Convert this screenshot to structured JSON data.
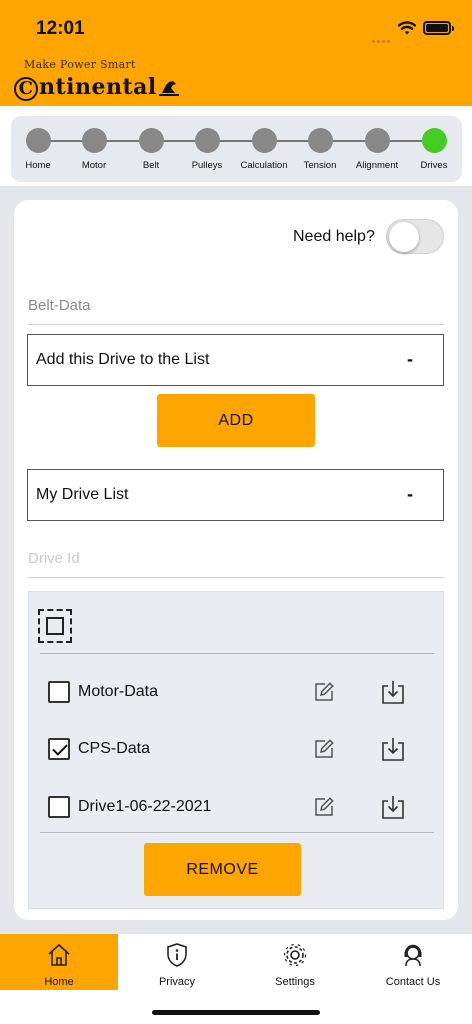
{
  "status_bar": {
    "time": "12:01"
  },
  "header": {
    "tagline": "Make Power Smart",
    "logo_text": "ntinental",
    "logo_initial": "C"
  },
  "stepper": {
    "steps": [
      {
        "label": "Home"
      },
      {
        "label": "Motor"
      },
      {
        "label": "Belt"
      },
      {
        "label": "Pulleys"
      },
      {
        "label": "Calculation"
      },
      {
        "label": "Tension"
      },
      {
        "label": "Alignment"
      },
      {
        "label": "Drives"
      }
    ],
    "active_step": "Drives"
  },
  "help": {
    "label": "Need help?",
    "enabled": false
  },
  "belt_data": {
    "label": "Belt-Data"
  },
  "add_drive": {
    "title": "Add this Drive to the List",
    "sign": "-",
    "button": "ADD"
  },
  "drive_list": {
    "title": "My Drive List",
    "sign": "-"
  },
  "drive_id": {
    "placeholder": "Drive Id"
  },
  "drives": {
    "items": [
      {
        "name": "Motor-Data",
        "checked": false
      },
      {
        "name": "CPS-Data",
        "checked": true
      },
      {
        "name": "Drive1-06-22-2021",
        "checked": false
      }
    ],
    "remove_button": "REMOVE"
  },
  "bottom_nav": {
    "items": [
      {
        "label": "Home",
        "icon": "home-icon",
        "active": true
      },
      {
        "label": "Privacy",
        "icon": "info-shield-icon",
        "active": false
      },
      {
        "label": "Settings",
        "icon": "gear-icon",
        "active": false
      },
      {
        "label": "Contact Us",
        "icon": "support-agent-icon",
        "active": false
      }
    ]
  },
  "colors": {
    "brand": "#ffa500",
    "active_step": "#44cc22",
    "inactive_step": "#888888"
  }
}
